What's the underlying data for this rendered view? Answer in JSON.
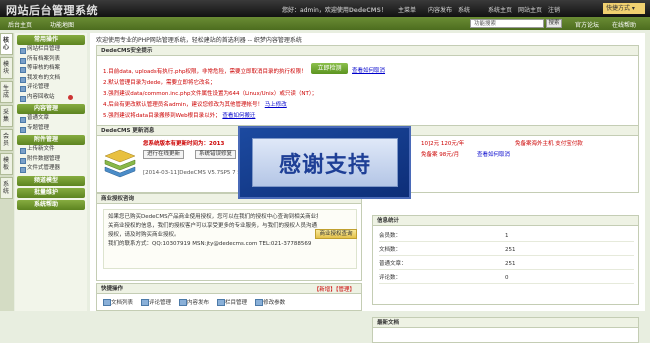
{
  "header": {
    "title": "网站后台管理系统",
    "user_text": "您好：",
    "user_name": "admin",
    "user_suffix": "，欢迎使用DedeCMS！",
    "nav": [
      "主菜单",
      "内容发布",
      "系统",
      "系统主页",
      "网站主页",
      "注销"
    ],
    "switch_label": "快捷方式 ▾"
  },
  "toolbar": {
    "left_links": [
      "后台主页",
      "功能地图"
    ],
    "search_placeholder": "功能搜索",
    "search_button": "搜索",
    "official_forum": "官方论坛",
    "online_help": "在线帮助"
  },
  "vtabs": [
    "核心",
    "模块",
    "生成",
    "采集",
    "会员",
    "模板",
    "系统"
  ],
  "sidebar": {
    "groups": [
      {
        "title": "常用操作",
        "items": [
          "网站栏目管理",
          "所有档案列表",
          "等审核的档案",
          "我发布的文档",
          "评论管理",
          "内容回收站"
        ]
      },
      {
        "title": "内容管理",
        "items": [
          "普通文章",
          "专题管理"
        ]
      },
      {
        "title": "附件管理",
        "items": [
          "上传新文件",
          "附件数据管理",
          "文件式管理器"
        ]
      },
      {
        "title": "频道模型",
        "items": []
      },
      {
        "title": "批量维护",
        "items": []
      },
      {
        "title": "系统帮助",
        "items": []
      }
    ]
  },
  "main": {
    "welcome": "欢迎使用专业的PHP网站管理系统，轻松建站的首选利器 -- 织梦内容管理系统",
    "security": {
      "title": "DedeCMS安全提示",
      "lines": [
        "1.目前data, uploads有执行.php权限，非常危险，需要立即取消目录的执行权限！",
        "2.默认管理目录为dede，需要立即将它改名；",
        "3.强烈建议data/common.inc.php文件属性设置为644（Linux/Unix）或只读（NT）；",
        "4.后台有更改默认管理员名admin，建议您修改为其他管理帐号！",
        "5.强烈建议将data目录搬移到Web根目录以外；"
      ],
      "fix_button": "立即检测",
      "view_link": "查看如何取消",
      "line4_link": "马上修改",
      "line5_link": "查看如何搬迁"
    },
    "update": {
      "title": "DedeCMS 更新消息",
      "version_text": "您系统版本有更新时间为：2013",
      "btn_check": "进行在线更新",
      "btn_mod": "系统错误修复",
      "date_line": "[2014-03-11]DedeCMS V5.7SP5 7 SP",
      "right1": "10]2元 120元/年",
      "right1b": "免备案海外主机  支付宝付款",
      "right2": "免备案 98元/月",
      "right2b": "查看如何取消"
    },
    "business": {
      "title": "商业授权咨询",
      "text": [
        "如果您已购买DedeCMS产品商业使用授权，您可以在我们的授权中心查询到相关商业授权信息，如果您没有授权，请购买授权，我们拥有优惠的价格。",
        "关商业授权的信息，我们的授权客户可以享受更多的专业服务，与我们的授权人员沟通，",
        "授权，请及时购买商业授权。",
        "我们的联系方式：QQ:10307919 MSN:jty@dedecms.com TEL:021-37788569"
      ],
      "button": "商业授权查询"
    },
    "info": {
      "title": "信息统计",
      "rows": [
        {
          "label": "会员数：",
          "value": "1"
        },
        {
          "label": "文档数：",
          "value": "251"
        },
        {
          "label": "普通文章：",
          "value": "251"
        },
        {
          "label": "评论数：",
          "value": "0"
        }
      ]
    },
    "quick": {
      "title": "快捷操作",
      "edit": "【新增】【管理】",
      "links": [
        "文档列表",
        "评论管理",
        "内容发布",
        "栏目管理",
        "修改参数"
      ]
    },
    "latest": {
      "title": "最新文档"
    }
  },
  "overlay": {
    "text": "感谢支持"
  }
}
